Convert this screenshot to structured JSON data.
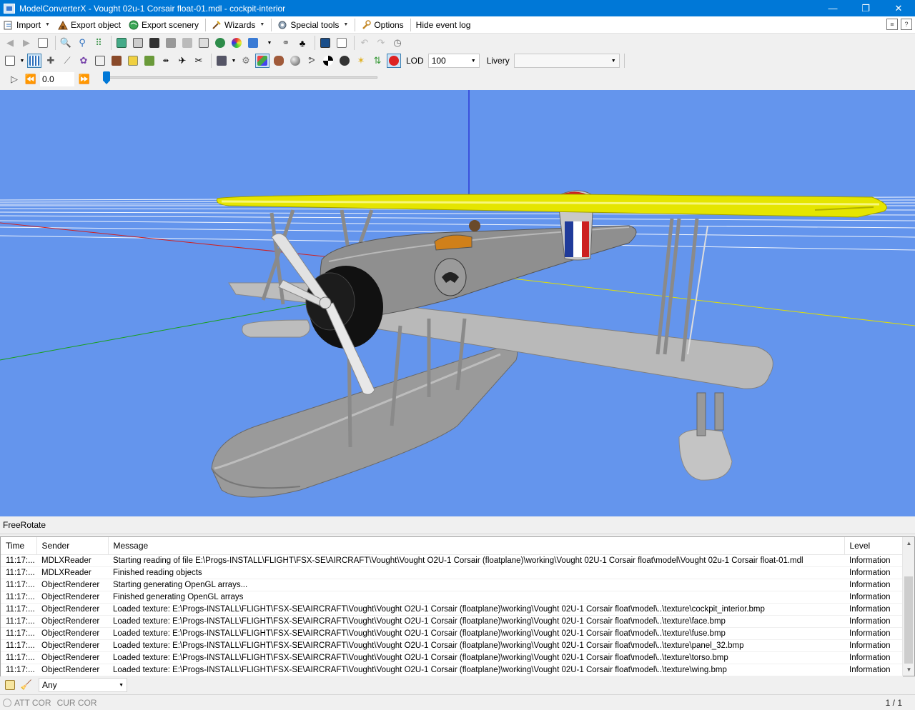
{
  "window": {
    "title": "ModelConverterX - Vought 02u-1 Corsair float-01.mdl - cockpit-interior",
    "minimize": "—",
    "restore": "❐",
    "close": "✕"
  },
  "menubar": {
    "items": [
      {
        "label": "Import",
        "icon": "import-icon",
        "dropdown": true
      },
      {
        "label": "Export object",
        "icon": "export-object-icon",
        "dropdown": false
      },
      {
        "label": "Export scenery",
        "icon": "export-scenery-icon",
        "dropdown": false
      },
      {
        "label": "Wizards",
        "icon": "wizard-icon",
        "dropdown": true
      },
      {
        "label": "Special tools",
        "icon": "gear-icon",
        "dropdown": true
      },
      {
        "label": "Options",
        "icon": "wrench-icon",
        "dropdown": false
      },
      {
        "label": "Hide event log",
        "icon": "",
        "dropdown": false
      }
    ]
  },
  "toolbar2": {
    "lod_label": "LOD",
    "lod_value": "100",
    "livery_label": "Livery",
    "livery_value": ""
  },
  "playback": {
    "time_value": "0.0"
  },
  "viewport": {
    "background": "#6495ed",
    "mode": "FreeRotate"
  },
  "event_log": {
    "columns": [
      "Time",
      "Sender",
      "Message",
      "Level"
    ],
    "rows": [
      {
        "time": "11:17:...",
        "sender": "MDLXReader",
        "message": "Starting reading of file E:\\Progs-INSTALL\\FLIGHT\\FSX-SE\\AIRCRAFT\\Vought\\Vought O2U-1 Corsair (floatplane)\\working\\Vought 02U-1 Corsair float\\model\\Vought 02u-1 Corsair float-01.mdl",
        "level": "Information"
      },
      {
        "time": "11:17:...",
        "sender": "MDLXReader",
        "message": "Finished reading objects",
        "level": "Information"
      },
      {
        "time": "11:17:...",
        "sender": "ObjectRenderer",
        "message": "Starting generating OpenGL arrays...",
        "level": "Information"
      },
      {
        "time": "11:17:...",
        "sender": "ObjectRenderer",
        "message": "Finished generating OpenGL arrays",
        "level": "Information"
      },
      {
        "time": "11:17:...",
        "sender": "ObjectRenderer",
        "message": "Loaded texture: E:\\Progs-INSTALL\\FLIGHT\\FSX-SE\\AIRCRAFT\\Vought\\Vought O2U-1 Corsair (floatplane)\\working\\Vought 02U-1 Corsair float\\model\\..\\texture\\cockpit_interior.bmp",
        "level": "Information"
      },
      {
        "time": "11:17:...",
        "sender": "ObjectRenderer",
        "message": "Loaded texture: E:\\Progs-INSTALL\\FLIGHT\\FSX-SE\\AIRCRAFT\\Vought\\Vought O2U-1 Corsair (floatplane)\\working\\Vought 02U-1 Corsair float\\model\\..\\texture\\face.bmp",
        "level": "Information"
      },
      {
        "time": "11:17:...",
        "sender": "ObjectRenderer",
        "message": "Loaded texture: E:\\Progs-INSTALL\\FLIGHT\\FSX-SE\\AIRCRAFT\\Vought\\Vought O2U-1 Corsair (floatplane)\\working\\Vought 02U-1 Corsair float\\model\\..\\texture\\fuse.bmp",
        "level": "Information"
      },
      {
        "time": "11:17:...",
        "sender": "ObjectRenderer",
        "message": "Loaded texture: E:\\Progs-INSTALL\\FLIGHT\\FSX-SE\\AIRCRAFT\\Vought\\Vought O2U-1 Corsair (floatplane)\\working\\Vought 02U-1 Corsair float\\model\\..\\texture\\panel_32.bmp",
        "level": "Information"
      },
      {
        "time": "11:17:...",
        "sender": "ObjectRenderer",
        "message": "Loaded texture: E:\\Progs-INSTALL\\FLIGHT\\FSX-SE\\AIRCRAFT\\Vought\\Vought O2U-1 Corsair (floatplane)\\working\\Vought 02U-1 Corsair float\\model\\..\\texture\\torso.bmp",
        "level": "Information"
      },
      {
        "time": "11:17:...",
        "sender": "ObjectRenderer",
        "message": "Loaded texture: E:\\Progs-INSTALL\\FLIGHT\\FSX-SE\\AIRCRAFT\\Vought\\Vought O2U-1 Corsair (floatplane)\\working\\Vought 02U-1 Corsair float\\model\\..\\texture\\wing.bmp",
        "level": "Information"
      }
    ]
  },
  "filter": {
    "value": "Any"
  },
  "status": {
    "att": "ATT COR",
    "cur": "CUR COR",
    "page": "1 / 1"
  },
  "colors": {
    "titlebar": "#0078d7",
    "viewport_bg": "#6495ed",
    "wing_top": "#e5e500",
    "fuselage": "#8c8c8c"
  }
}
